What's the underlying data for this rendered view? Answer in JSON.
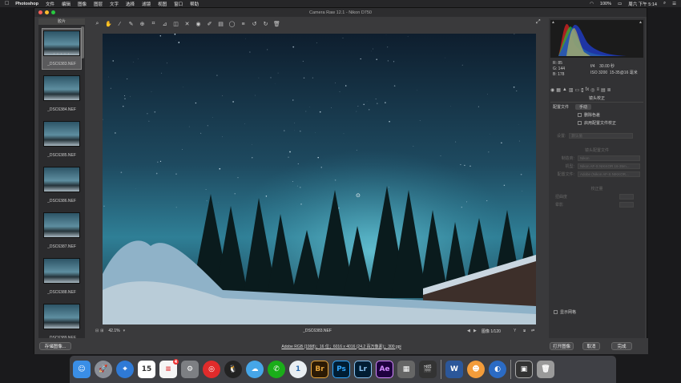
{
  "menubar": {
    "apple": "",
    "app_name": "Photoshop",
    "items": [
      "文件",
      "编辑",
      "图像",
      "图层",
      "文字",
      "选择",
      "滤镜",
      "视图",
      "窗口",
      "帮助"
    ],
    "battery": "100%",
    "clock": "周六 下午 5:14"
  },
  "window": {
    "title": "Camera Raw 12.1  -  Nikon D750",
    "filmstrip_header": "胶片",
    "thumbnails": [
      {
        "name": "_DSC6383.NEF",
        "selected": true,
        "stars": "• • • • •"
      },
      {
        "name": "_DSC6384.NEF"
      },
      {
        "name": "_DSC6385.NEF"
      },
      {
        "name": "_DSC6386.NEF"
      },
      {
        "name": "_DSC6387.NEF"
      },
      {
        "name": "_DSC6388.NEF"
      },
      {
        "name": "_DSC6389.NEF"
      }
    ],
    "zoom": "42.1%",
    "current_file": "_DSC6383.NEF",
    "image_counter": "图像 1/120"
  },
  "panel": {
    "rgb": {
      "r_label": "R:",
      "r": "85",
      "g_label": "G:",
      "g": "144",
      "b_label": "B:",
      "b": "178"
    },
    "exif": {
      "aperture": "f/4",
      "shutter": "30.00 秒",
      "iso": "ISO 3200",
      "lens": "15-35@16 毫米"
    },
    "section_title": "镜头校正",
    "subtabs": [
      "配置文件",
      "手动"
    ],
    "checkboxes": [
      "删除色差",
      "启用配置文件校正"
    ],
    "setup_label": "设置:",
    "setup_value": "默认值",
    "lens_profile_title": "镜头配置文件",
    "make_label": "制造商:",
    "make_value": "Nikon",
    "model_label": "机型:",
    "model_value": "Nikon AF-S NIKKOR 16-35m...",
    "profile_label": "配置文件:",
    "profile_value": "Adobe (Nikon AF-S NIKKOR...",
    "amount_title": "校正量",
    "distortion_label": "扭曲度",
    "vignette_label": "晕影",
    "show_grid": "显示网格"
  },
  "footer": {
    "save_label": "存储图像...",
    "info": "Adobe RGB (1998)；16 位；6016 x 4016 (24.2 百万像素)；300 ppi",
    "open_label": "打开图像",
    "cancel_label": "取消",
    "done_label": "完成"
  },
  "dock": {
    "calendar_day": "15",
    "badge": "4",
    "br": "Br",
    "ps": "Ps",
    "lr": "Lr",
    "ae": "Ae",
    "w": "W",
    "one": "1"
  }
}
